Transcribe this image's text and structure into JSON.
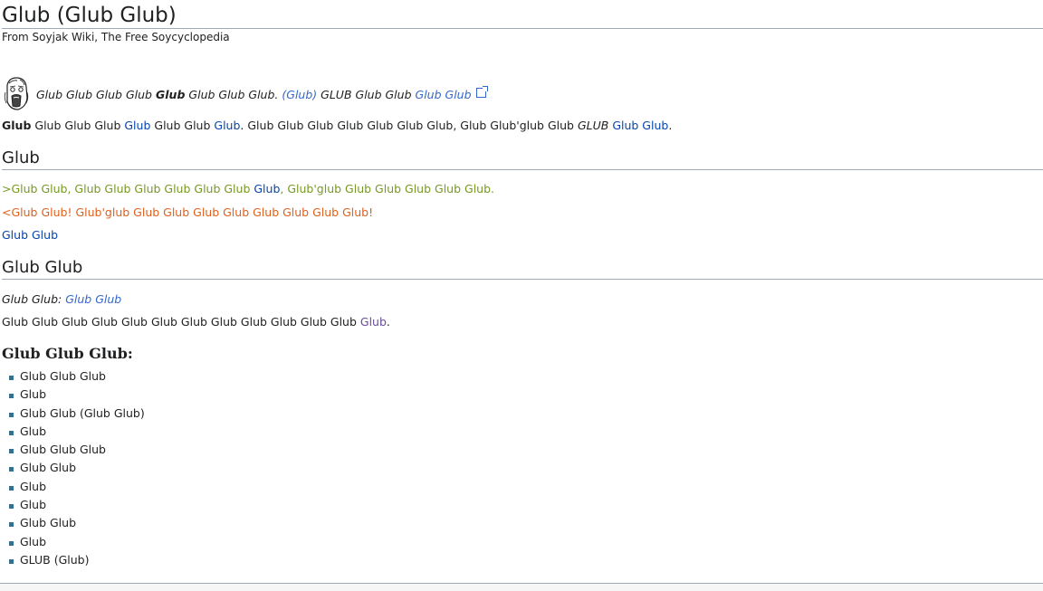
{
  "header": {
    "title": "Glub (Glub Glub)",
    "subtitle": "From Soyjak Wiki, The Free Soycyclopedia"
  },
  "hatnote": {
    "icon": "soyjak-face-icon",
    "t1": "Glub Glub Glub Glub",
    "t2_bold": "Glub",
    "t3": "Glub Glub Glub.",
    "link1": "(Glub)",
    "t4": "GLUB Glub Glub",
    "ext_link": "Glub Glub"
  },
  "intro": {
    "b": "Glub",
    "t1": "Glub Glub Glub",
    "l1": "Glub",
    "t2": "Glub Glub",
    "l2": "Glub",
    "t3": ". Glub Glub Glub Glub Glub Glub Glub, Glub Glub'glub Glub",
    "i": "GLUB",
    "l3": "Glub Glub",
    "end": "."
  },
  "section1": {
    "heading": "Glub",
    "green_a": ">Glub Glub, Glub Glub Glub Glub Glub Glub",
    "green_link": "Glub",
    "green_b": ", Glub'glub Glub Glub Glub Glub Glub.",
    "orange": "<Glub Glub! Glub'glub Glub Glub Glub Glub Glub Glub Glub Glub!",
    "link": "Glub Glub"
  },
  "section2": {
    "heading": "Glub Glub",
    "see_also_label": "Glub Glub:",
    "see_also_link": "Glub Glub",
    "para": "Glub Glub Glub Glub Glub Glub Glub Glub Glub Glub Glub Glub",
    "para_link": "Glub",
    "para_end": "."
  },
  "section3": {
    "heading": "Glub Glub Glub:",
    "items": [
      "Glub Glub Glub",
      "Glub",
      "Glub Glub (Glub Glub)",
      "Glub",
      "Glub Glub Glub",
      "Glub Glub",
      "Glub",
      "Glub",
      "Glub Glub",
      "Glub",
      "GLUB (Glub)"
    ]
  },
  "colors": {
    "link": "#0645ad",
    "greentext": "#789922",
    "orangetext": "#e0601e"
  }
}
